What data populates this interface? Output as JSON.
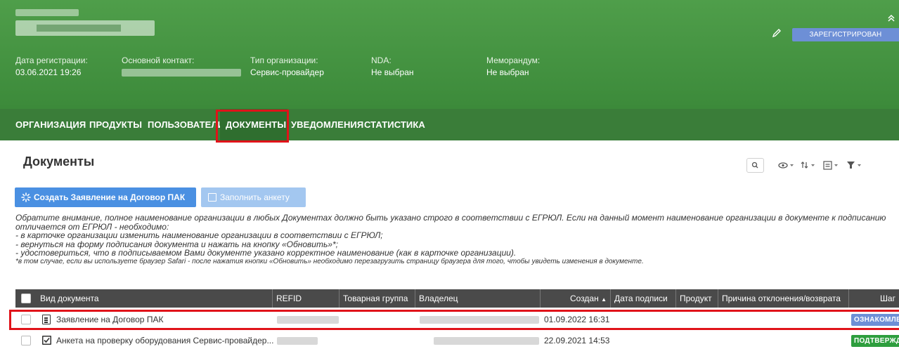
{
  "header": {
    "fields": [
      {
        "label": "Дата регистрации:",
        "value": "03.06.2021 19:26"
      },
      {
        "label": "Основной контакт:",
        "value": ""
      },
      {
        "label": "Тип организации:",
        "value": "Сервис-провайдер"
      },
      {
        "label": "NDA:",
        "value": "Не выбран"
      },
      {
        "label": "Меморандум:",
        "value": "Не выбран"
      }
    ],
    "status": "ЗАРЕГИСТРИРОВАН"
  },
  "tabs": [
    "ОРГАНИЗАЦИЯ",
    "ПРОДУКТЫ",
    "ПОЛЬЗОВАТЕЛИ",
    "ДОКУМЕНТЫ",
    "УВЕДОМЛЕНИЯ",
    "СТАТИСТИКА"
  ],
  "active_tab": "ДОКУМЕНТЫ",
  "page": {
    "title": "Документы",
    "create_button": "Создать Заявление на Договор ПАК",
    "fill_button": "Заполнить анкету"
  },
  "notice": {
    "line1": "Обратите внимание, полное наименование организации в любых Документах должно быть указано строго в соответствии с ЕГРЮЛ. Если на данный момент наименование организации в документе к подписанию отличается от ЕГРЮЛ - необходимо:",
    "line2": "- в карточке организации изменить наименование организации в соответствии с ЕГРЮЛ;",
    "line3": "- вернуться на форму подписания документа и нажать на кнопку «Обновить»*;",
    "line4": "- удостовериться, что в подписываемом Вами документе указано корректное наименование (как в карточке организации).",
    "footnote": "*в том случае, если вы используете браузер Safari - после нажатия кнопки «Обновить» необходимо перезагрузить страницу браузера для того, чтобы увидеть изменения в документе."
  },
  "table": {
    "columns": [
      "Вид документа",
      "REFID",
      "Товарная группа",
      "Владелец",
      "Создан",
      "Дата подписи",
      "Продукт",
      "Причина отклонения/возврата",
      "Шаг"
    ],
    "sort_indicator": "▲",
    "rows": [
      {
        "type": "Заявление на Договор ПАК",
        "created": "01.09.2022 16:31",
        "step": "ОЗНАКОМЛЕНИЕ",
        "step_color": "#6d8fd6",
        "icon": "document-icon"
      },
      {
        "type": "Анкета на проверку оборудования Сервис-провайдер...",
        "created": "22.09.2021 14:53",
        "step": "ПОДТВЕРЖДЕНИЕ",
        "step_color": "#2e9e3e",
        "icon": "checkbox-icon"
      }
    ]
  }
}
